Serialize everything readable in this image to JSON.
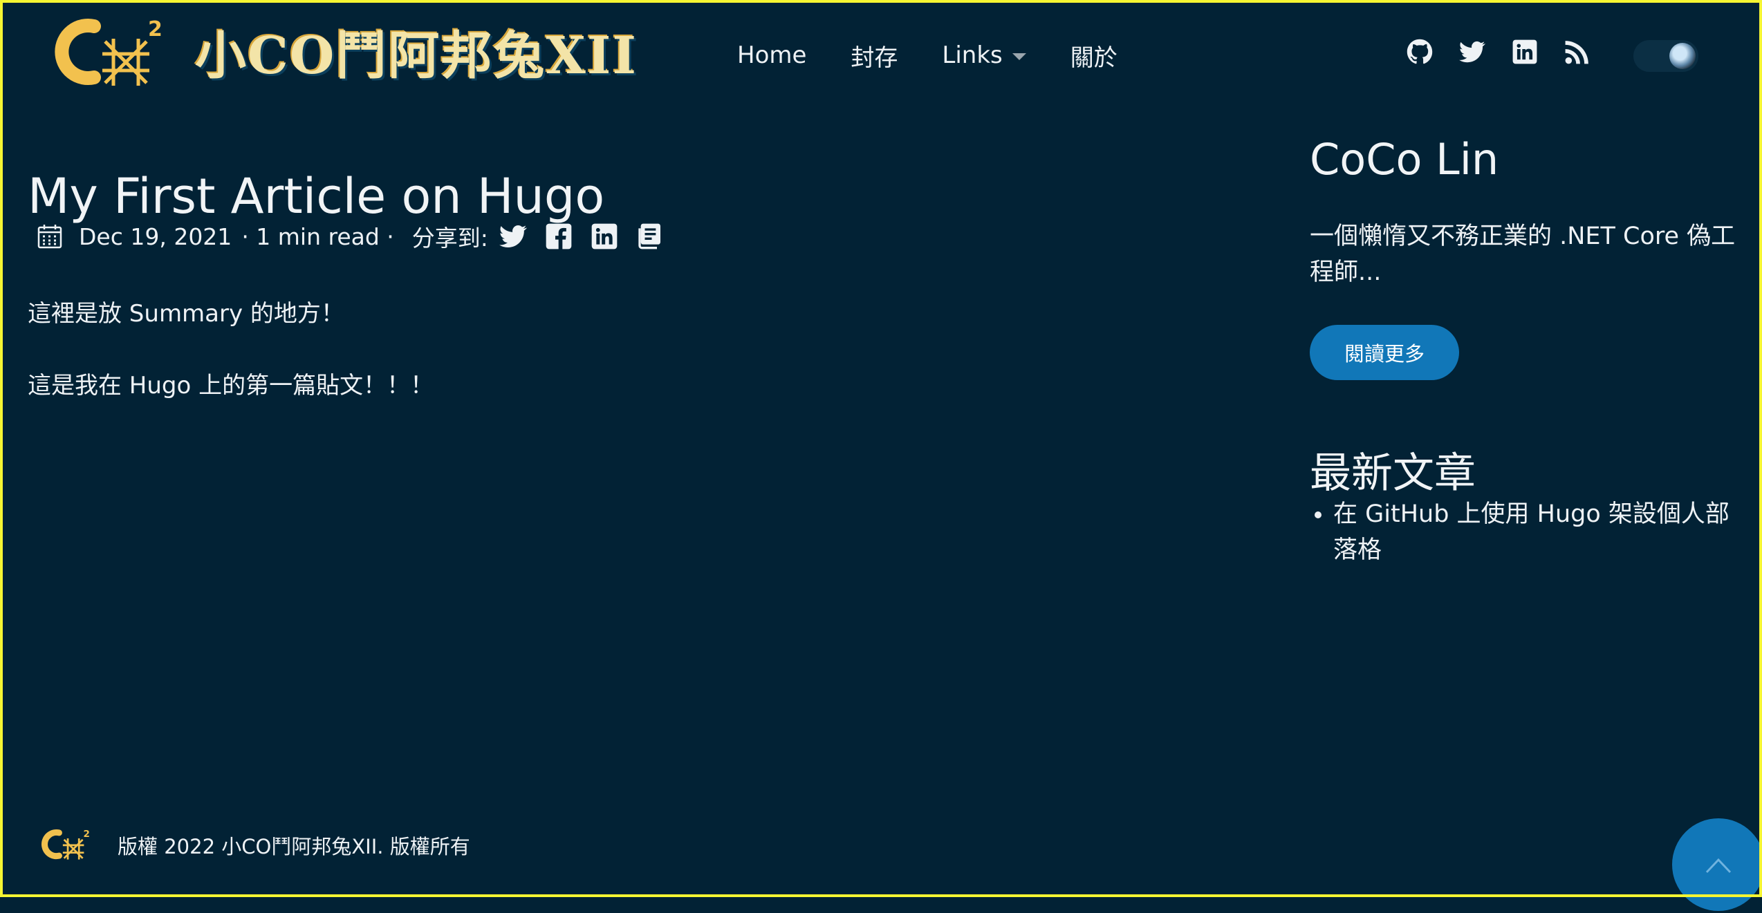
{
  "header": {
    "site_title": "小CO鬥阿邦兔XII",
    "nav": [
      {
        "label": "Home"
      },
      {
        "label": "封存"
      },
      {
        "label": "Links"
      },
      {
        "label": "關於"
      }
    ],
    "social_icons": [
      "github-icon",
      "twitter-icon",
      "linkedin-icon",
      "rss-icon"
    ]
  },
  "post": {
    "title": "My First Article on Hugo",
    "date": "Dec 19, 2021",
    "read_time": "· 1 min read ·",
    "share_label": "分享到:",
    "share_icons": [
      "twitter-icon",
      "facebook-icon",
      "linkedin-icon",
      "copy-icon"
    ],
    "summary": "這裡是放 Summary 的地方！",
    "body": "這是我在 Hugo 上的第一篇貼文！！！"
  },
  "sidebar": {
    "author": "CoCo Lin",
    "bio": "一個懶惰又不務正業的 .NET Core 偽工程師...",
    "read_more": "閱讀更多",
    "recent_title": "最新文章",
    "recent_posts": [
      "在 GitHub 上使用 Hugo 架設個人部落格"
    ]
  },
  "footer": {
    "copyright": "版權 2022 小CO鬥阿邦兔XII. 版權所有"
  },
  "colors": {
    "background": "#022235",
    "accent": "#1177b8",
    "logo_gold": "#f2c14e",
    "frame": "#f5f532"
  }
}
